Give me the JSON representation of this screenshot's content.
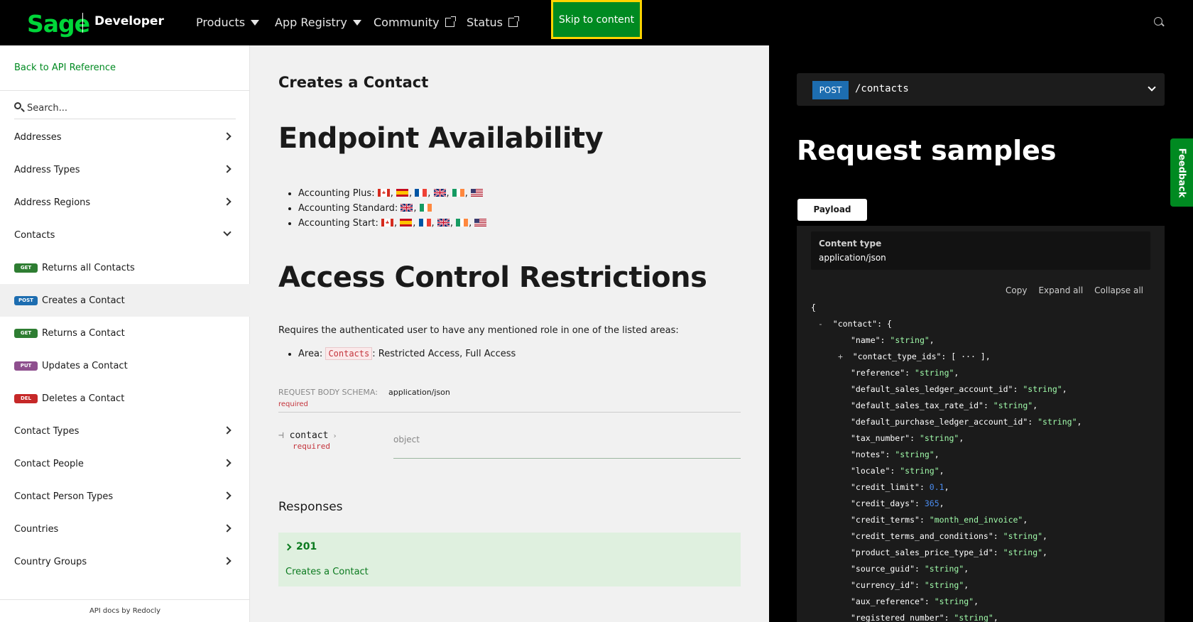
{
  "topnav": {
    "logo": "Sage",
    "developer": "Developer",
    "items": [
      {
        "label": "Products",
        "type": "dropdown"
      },
      {
        "label": "App Registry",
        "type": "dropdown"
      },
      {
        "label": "Community",
        "type": "external"
      },
      {
        "label": "Status",
        "type": "external"
      }
    ],
    "skip_label": "Skip to content"
  },
  "sidebar": {
    "back_label": "Back to API Reference",
    "search_placeholder": "Search...",
    "items": [
      {
        "label": "Addresses",
        "kind": "group"
      },
      {
        "label": "Address Types",
        "kind": "group"
      },
      {
        "label": "Address Regions",
        "kind": "group"
      },
      {
        "label": "Contacts",
        "kind": "group-open"
      },
      {
        "label": "Returns all Contacts",
        "method": "GET"
      },
      {
        "label": "Creates a Contact",
        "method": "POST",
        "active": true
      },
      {
        "label": "Returns a Contact",
        "method": "GET"
      },
      {
        "label": "Updates a Contact",
        "method": "PUT"
      },
      {
        "label": "Deletes a Contact",
        "method": "DEL"
      },
      {
        "label": "Contact Types",
        "kind": "group"
      },
      {
        "label": "Contact People",
        "kind": "group"
      },
      {
        "label": "Contact Person Types",
        "kind": "group"
      },
      {
        "label": "Countries",
        "kind": "group"
      },
      {
        "label": "Country Groups",
        "kind": "group"
      }
    ],
    "footer": "API docs by Redocly"
  },
  "main": {
    "title": "Creates a Contact",
    "h_availability": "Endpoint Availability",
    "availability": [
      {
        "label": "Accounting Plus:",
        "flags": [
          "ca",
          "es",
          "fr",
          "gb",
          "ie",
          "us"
        ]
      },
      {
        "label": "Accounting Standard:",
        "flags": [
          "gb",
          "ie"
        ]
      },
      {
        "label": "Accounting Start:",
        "flags": [
          "ca",
          "es",
          "fr",
          "gb",
          "ie",
          "us"
        ]
      }
    ],
    "h_access": "Access Control Restrictions",
    "access_para": "Requires the authenticated user to have any mentioned role in one of the listed areas:",
    "area_prefix": "Area:",
    "area_tag": "Contacts",
    "area_suffix": ": Restricted Access, Full Access",
    "schema_label": "REQUEST BODY SCHEMA:",
    "schema_value": "application/json",
    "schema_required": "required",
    "prop_name": "contact",
    "prop_required": "required",
    "prop_type": "object",
    "responses_label": "Responses",
    "response_code": "201",
    "response_desc": "Creates a Contact"
  },
  "right": {
    "method": "POST",
    "path": "/contacts",
    "title": "Request samples",
    "tab": "Payload",
    "content_type_label": "Content type",
    "content_type_value": "application/json",
    "actions": [
      "Copy",
      "Expand all",
      "Collapse all"
    ],
    "code_lines": [
      {
        "t": "{",
        "indent": 0
      },
      {
        "toggle": "-",
        "key": "\"contact\"",
        "punct": ": {",
        "indent": 1
      },
      {
        "key": "\"name\"",
        "sval": "\"string\"",
        "indent": 2
      },
      {
        "toggle": "+",
        "key": "\"contact_type_ids\"",
        "punct": ": [ ··· ],",
        "indent": 2
      },
      {
        "key": "\"reference\"",
        "sval": "\"string\"",
        "indent": 2
      },
      {
        "key": "\"default_sales_ledger_account_id\"",
        "sval": "\"string\"",
        "indent": 2
      },
      {
        "key": "\"default_sales_tax_rate_id\"",
        "sval": "\"string\"",
        "indent": 2
      },
      {
        "key": "\"default_purchase_ledger_account_id\"",
        "sval": "\"string\"",
        "indent": 2
      },
      {
        "key": "\"tax_number\"",
        "sval": "\"string\"",
        "indent": 2
      },
      {
        "key": "\"notes\"",
        "sval": "\"string\"",
        "indent": 2
      },
      {
        "key": "\"locale\"",
        "sval": "\"string\"",
        "indent": 2
      },
      {
        "key": "\"credit_limit\"",
        "nval": "0.1",
        "indent": 2
      },
      {
        "key": "\"credit_days\"",
        "nval": "365",
        "indent": 2
      },
      {
        "key": "\"credit_terms\"",
        "sval": "\"month_end_invoice\"",
        "indent": 2
      },
      {
        "key": "\"credit_terms_and_conditions\"",
        "sval": "\"string\"",
        "indent": 2
      },
      {
        "key": "\"product_sales_price_type_id\"",
        "sval": "\"string\"",
        "indent": 2
      },
      {
        "key": "\"source_guid\"",
        "sval": "\"string\"",
        "indent": 2
      },
      {
        "key": "\"currency_id\"",
        "sval": "\"string\"",
        "indent": 2
      },
      {
        "key": "\"aux_reference\"",
        "sval": "\"string\"",
        "indent": 2
      },
      {
        "key": "\"registered_number\"",
        "sval": "\"string\"",
        "indent": 2
      }
    ],
    "feedback": "Feedback"
  },
  "colors": {
    "brand": "#00D639",
    "get": "#2e7d32",
    "post": "#1d6db0",
    "put": "#8e4f8e",
    "del": "#c62828"
  }
}
